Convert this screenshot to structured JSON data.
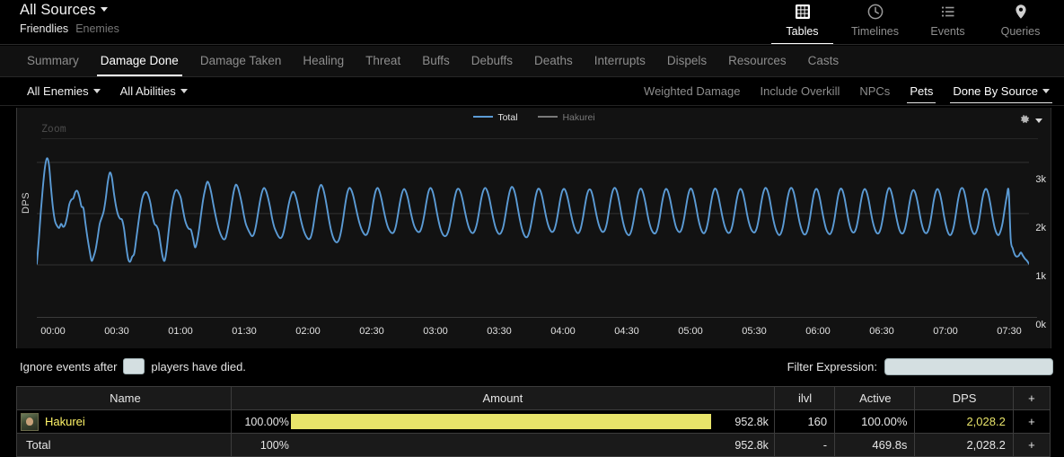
{
  "header": {
    "source_label": "All Sources",
    "friendlies_label": "Friendlies",
    "enemies_label": "Enemies",
    "nav": [
      {
        "label": "Tables",
        "icon": "grid-icon",
        "active": true
      },
      {
        "label": "Timelines",
        "icon": "clock-icon",
        "active": false
      },
      {
        "label": "Events",
        "icon": "list-icon",
        "active": false
      },
      {
        "label": "Queries",
        "icon": "map-pin-icon",
        "active": false
      }
    ]
  },
  "tabs": [
    {
      "label": "Summary",
      "active": false
    },
    {
      "label": "Damage Done",
      "active": true
    },
    {
      "label": "Damage Taken",
      "active": false
    },
    {
      "label": "Healing",
      "active": false
    },
    {
      "label": "Threat",
      "active": false
    },
    {
      "label": "Buffs",
      "active": false
    },
    {
      "label": "Debuffs",
      "active": false
    },
    {
      "label": "Deaths",
      "active": false
    },
    {
      "label": "Interrupts",
      "active": false
    },
    {
      "label": "Dispels",
      "active": false
    },
    {
      "label": "Resources",
      "active": false
    },
    {
      "label": "Casts",
      "active": false
    }
  ],
  "filterbar": {
    "left": [
      {
        "label": "All Enemies",
        "caret": true
      },
      {
        "label": "All Abilities",
        "caret": true
      }
    ],
    "right": [
      {
        "label": "Weighted Damage",
        "active": false,
        "caret": false
      },
      {
        "label": "Include Overkill",
        "active": false,
        "caret": false
      },
      {
        "label": "NPCs",
        "active": false,
        "caret": false
      },
      {
        "label": "Pets",
        "active": true,
        "caret": false
      },
      {
        "label": "Done By Source",
        "active": true,
        "caret": true
      }
    ]
  },
  "chart": {
    "zoom_label": "Zoom",
    "gear_icon": "gear-icon",
    "legend": [
      {
        "label": "Total",
        "color": "#5b9bd5"
      },
      {
        "label": "Hakurei",
        "color": "#7a7a7a"
      }
    ]
  },
  "chart_data": {
    "type": "line",
    "title": "",
    "xlabel": "",
    "ylabel": "DPS",
    "ylim": [
      0,
      3400
    ],
    "yticks": [
      0,
      1000,
      2000,
      3000
    ],
    "ytick_labels": [
      "0k",
      "1k",
      "2k",
      "3k"
    ],
    "grid": true,
    "legend_position": "top-center",
    "xtick_labels": [
      "00:00",
      "00:30",
      "01:00",
      "01:30",
      "02:00",
      "02:30",
      "03:00",
      "03:30",
      "04:00",
      "04:30",
      "05:00",
      "05:30",
      "06:00",
      "06:30",
      "07:00",
      "07:30"
    ],
    "x_range_seconds": [
      0,
      480
    ],
    "series": [
      {
        "name": "Total",
        "color": "#5b9bd5",
        "values": [
          1020,
          1500,
          2050,
          2520,
          2900,
          3080,
          2950,
          2500,
          2100,
          1850,
          1760,
          1720,
          1800,
          1740,
          1790,
          1950,
          2180,
          2270,
          2300,
          2420,
          2440,
          2320,
          2140,
          2100,
          1800,
          1520,
          1280,
          1080,
          1160,
          1300,
          1540,
          1800,
          1920,
          2050,
          2300,
          2620,
          2800,
          2700,
          2400,
          2150,
          1980,
          1900,
          1880,
          1700,
          1380,
          1120,
          1060,
          1160,
          1220,
          1500,
          1800,
          2080,
          2300,
          2400,
          2420,
          2350,
          2200,
          1960,
          1800,
          1760,
          1660,
          1400,
          1160,
          1080,
          1300,
          1660,
          2000,
          2260,
          2420,
          2460,
          2400,
          2300,
          2080,
          1880,
          1760,
          1700,
          1680,
          1520,
          1340,
          1460,
          1700,
          2000,
          2280,
          2480,
          2620,
          2560,
          2400,
          2180,
          1980,
          1800,
          1660,
          1560,
          1500,
          1520,
          1680,
          1900,
          2180,
          2420,
          2560,
          2520,
          2380,
          2200,
          1980,
          1800,
          1700,
          1620,
          1560,
          1600,
          1760,
          2000,
          2240,
          2420,
          2500,
          2440,
          2300,
          2120,
          1900,
          1740,
          1640,
          1560,
          1520,
          1560,
          1700,
          1920,
          2150,
          2320,
          2420,
          2400,
          2280,
          2100,
          1900,
          1740,
          1620,
          1540,
          1500,
          1540,
          1700,
          1960,
          2240,
          2460,
          2560,
          2500,
          2340,
          2120,
          1880,
          1680,
          1540,
          1460,
          1440,
          1500,
          1660,
          1900,
          2180,
          2400,
          2500,
          2460,
          2340,
          2160,
          1980,
          1820,
          1700,
          1620,
          1580,
          1620,
          1760,
          2000,
          2260,
          2440,
          2500,
          2420,
          2260,
          2060,
          1880,
          1740,
          1660,
          1620,
          1640,
          1760,
          1980,
          2220,
          2400,
          2480,
          2420,
          2280,
          2080,
          1900,
          1760,
          1680,
          1640,
          1660,
          1780,
          1980,
          2220,
          2420,
          2500,
          2440,
          2280,
          2060,
          1860,
          1700,
          1600,
          1560,
          1580,
          1680,
          1860,
          2100,
          2320,
          2460,
          2480,
          2400,
          2240,
          2040,
          1860,
          1720,
          1640,
          1620,
          1680,
          1820,
          2040,
          2280,
          2440,
          2500,
          2440,
          2300,
          2100,
          1900,
          1740,
          1640,
          1600,
          1640,
          1760,
          1980,
          2220,
          2420,
          2520,
          2480,
          2340,
          2120,
          1900,
          1720,
          1600,
          1540,
          1560,
          1680,
          1880,
          2140,
          2360,
          2480,
          2460,
          2340,
          2140,
          1940,
          1780,
          1680,
          1640,
          1680,
          1820,
          2040,
          2280,
          2440,
          2480,
          2400,
          2240,
          2040,
          1860,
          1720,
          1640,
          1620,
          1700,
          1880,
          2120,
          2340,
          2460,
          2460,
          2340,
          2140,
          1940,
          1780,
          1680,
          1640,
          1680,
          1820,
          2060,
          2300,
          2460,
          2500,
          2420,
          2240,
          2020,
          1820,
          1680,
          1600,
          1580,
          1660,
          1840,
          2080,
          2320,
          2460,
          2480,
          2380,
          2200,
          1980,
          1800,
          1680,
          1620,
          1620,
          1720,
          1920,
          2180,
          2380,
          2480,
          2440,
          2300,
          2100,
          1900,
          1740,
          1660,
          1640,
          1720,
          1900,
          2140,
          2360,
          2480,
          2460,
          2320,
          2120,
          1900,
          1740,
          1640,
          1620,
          1700,
          1880,
          2140,
          2360,
          2480,
          2460,
          2320,
          2120,
          1920,
          1760,
          1660,
          1620,
          1660,
          1800,
          2040,
          2280,
          2440,
          2480,
          2400,
          2220,
          2000,
          1820,
          1700,
          1640,
          1640,
          1740,
          1940,
          2200,
          2400,
          2500,
          2460,
          2320,
          2100,
          1880,
          1720,
          1620,
          1580,
          1640,
          1800,
          2060,
          2300,
          2460,
          2500,
          2420,
          2240,
          2020,
          1820,
          1680,
          1600,
          1600,
          1700,
          1900,
          2160,
          2380,
          2480,
          2440,
          2280,
          2060,
          1860,
          1700,
          1620,
          1600,
          1680,
          1860,
          2120,
          2360,
          2480,
          2460,
          2320,
          2100,
          1880,
          1720,
          1640,
          1640,
          1740,
          1940,
          2200,
          2400,
          2480,
          2420,
          2260,
          2040,
          1840,
          1700,
          1620,
          1620,
          1720,
          1920,
          2180,
          2400,
          2500,
          2440,
          2280,
          2060,
          1860,
          1700,
          1620,
          1620,
          1720,
          1920,
          2180,
          2380,
          2460,
          2400,
          2240,
          2020,
          1820,
          1680,
          1620,
          1640,
          1760,
          1980,
          2240,
          2420,
          2480,
          2400,
          2220,
          1980,
          1780,
          1640,
          1580,
          1620,
          1760,
          2000,
          2260,
          2440,
          2500,
          2440,
          2260,
          2020,
          1800,
          1660,
          1600,
          1640,
          1780,
          2020,
          2280,
          2440,
          2480,
          2380,
          2180,
          1940,
          1740,
          1620,
          1580,
          1660,
          1820,
          2080,
          2320,
          2440,
          1500,
          1320,
          1200,
          1160,
          1180,
          1240,
          1180,
          1120,
          1080,
          1020
        ]
      }
    ]
  },
  "ignore_row": {
    "prefix": "Ignore events after",
    "suffix": "players have died.",
    "count_value": "",
    "filter_label": "Filter Expression:",
    "filter_value": "",
    "filter_placeholder": ""
  },
  "table": {
    "columns": [
      "Name",
      "Amount",
      "ilvl",
      "Active",
      "DPS",
      "+"
    ],
    "rows": [
      {
        "name": "Hakurei",
        "percent": "100.00%",
        "bar_pct": 100,
        "amount": "952.8k",
        "ilvl": "160",
        "active": "100.00%",
        "dps": "2,028.2",
        "plus": "+",
        "is_total": false
      },
      {
        "name": "Total",
        "percent": "100%",
        "bar_pct": 0,
        "amount": "952.8k",
        "ilvl": "-",
        "active": "469.8s",
        "dps": "2,028.2",
        "plus": "+",
        "is_total": true
      }
    ]
  },
  "colors": {
    "accent_line": "#5b9bd5",
    "bar_fill": "#e8e46a",
    "player_name": "#fff468",
    "background": "#000000",
    "panel": "#121212"
  }
}
